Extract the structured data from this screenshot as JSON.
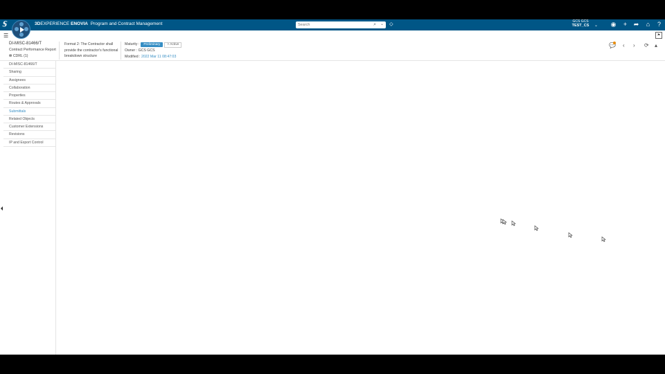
{
  "topbar": {
    "brand_bold": "3D",
    "brand_main": "EXPERIENCE",
    "brand_app": "ENOVIA",
    "brand_module": "Program and Contract Management",
    "search_placeholder": "Search",
    "user_line1": "GCS GCS",
    "user_line2": "TEST_CS"
  },
  "object": {
    "title": "DI-MISC-81466/T",
    "subtitle": "Contract Performance Report",
    "cdrl": "CDRL (1)",
    "description": "Format 2: The Contractor shall provide the contractor's functional breakdown structure",
    "maturity_label": "Maturity :",
    "maturity_value": "Preliminary",
    "maturity_next": "> Active",
    "owner": "Owner : GCS GCS",
    "modified_label": "Modified :",
    "modified_value": "2022 Mar 11 08:47:03"
  },
  "nav": {
    "items": [
      {
        "label": "DI-MISC-81466/T"
      },
      {
        "label": "Sharing"
      },
      {
        "label": "Assignees"
      },
      {
        "label": "Collaboration"
      },
      {
        "label": "Properties"
      },
      {
        "label": "Routes & Approvals"
      },
      {
        "label": "Submittals"
      },
      {
        "label": "Related Objects"
      },
      {
        "label": "Customer Extensions"
      },
      {
        "label": "Revisions"
      },
      {
        "label": "IP and Export Control"
      }
    ],
    "active_index": 6
  },
  "colors": {
    "topbar": "#005686",
    "accent": "#368ec4",
    "notification": "#e88b00"
  },
  "icons": [
    "3ds-logo-icon",
    "compass-icon",
    "search-icon",
    "tag-icon",
    "user-icon",
    "add-icon",
    "share-icon",
    "home-icon",
    "help-icon",
    "menu-icon",
    "flag-icon",
    "chat-icon",
    "previous-icon",
    "next-icon",
    "refresh-icon",
    "collapse-up-icon",
    "cursor-icon"
  ]
}
